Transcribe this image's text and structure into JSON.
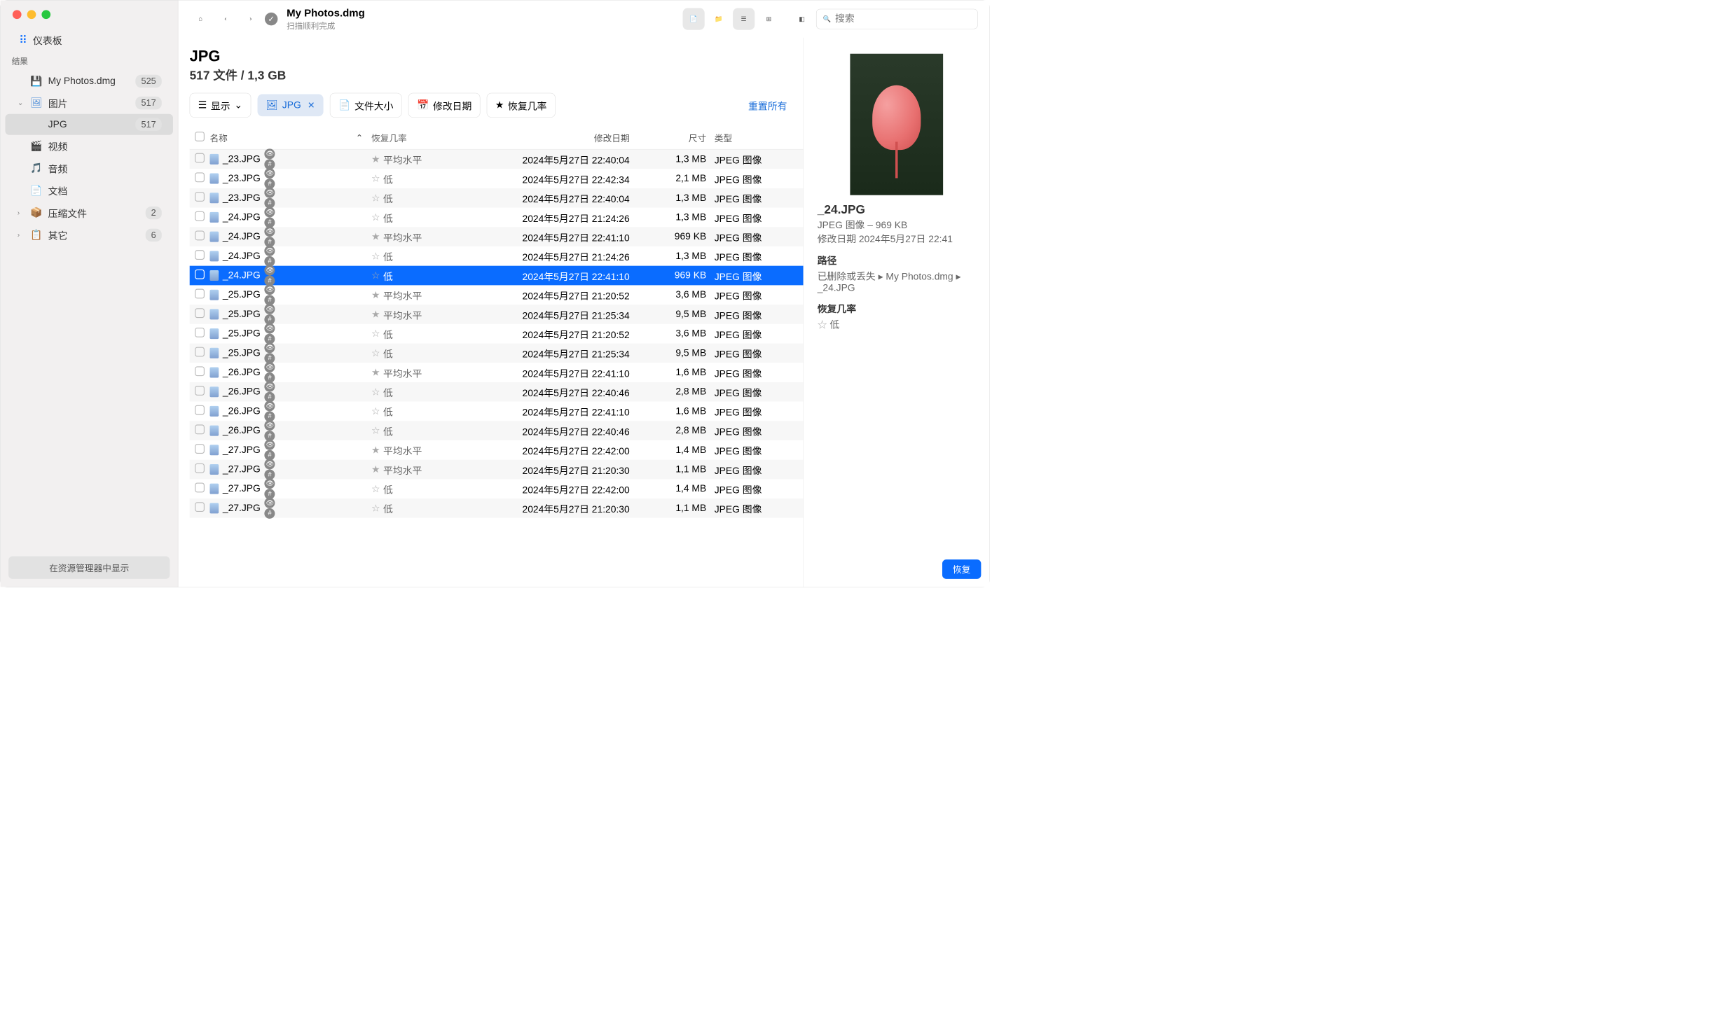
{
  "window": {
    "title": "My Photos.dmg",
    "status": "扫描顺利完成"
  },
  "search": {
    "placeholder": "搜索"
  },
  "sidebar": {
    "dashboard": "仪表板",
    "section": "结果",
    "items": [
      {
        "label": "My Photos.dmg",
        "badge": "525"
      },
      {
        "label": "图片",
        "badge": "517"
      },
      {
        "label": "JPG",
        "badge": "517",
        "selected": true
      },
      {
        "label": "视频"
      },
      {
        "label": "音频"
      },
      {
        "label": "文档"
      },
      {
        "label": "压缩文件",
        "badge": "2"
      },
      {
        "label": "其它",
        "badge": "6"
      }
    ],
    "bottom": "在资源管理器中显示"
  },
  "heading": {
    "title": "JPG",
    "subtitle": "517 文件 / 1,3 GB"
  },
  "filters": {
    "show": "显示",
    "jpg": "JPG",
    "size": "文件大小",
    "date": "修改日期",
    "recovery": "恢复几率",
    "reset": "重置所有"
  },
  "cols": {
    "name": "名称",
    "recovery": "恢复几率",
    "date": "修改日期",
    "size": "尺寸",
    "type": "类型"
  },
  "rows": [
    {
      "name": "_23.JPG",
      "rec": "平均水平",
      "date": "2024年5月27日 22:40:04",
      "size": "1,3 MB",
      "type": "JPEG 图像"
    },
    {
      "name": "_23.JPG",
      "rec": "低",
      "date": "2024年5月27日 22:42:34",
      "size": "2,1 MB",
      "type": "JPEG 图像"
    },
    {
      "name": "_23.JPG",
      "rec": "低",
      "date": "2024年5月27日 22:40:04",
      "size": "1,3 MB",
      "type": "JPEG 图像"
    },
    {
      "name": "_24.JPG",
      "rec": "低",
      "date": "2024年5月27日 21:24:26",
      "size": "1,3 MB",
      "type": "JPEG 图像"
    },
    {
      "name": "_24.JPG",
      "rec": "平均水平",
      "date": "2024年5月27日 22:41:10",
      "size": "969 KB",
      "type": "JPEG 图像"
    },
    {
      "name": "_24.JPG",
      "rec": "低",
      "date": "2024年5月27日 21:24:26",
      "size": "1,3 MB",
      "type": "JPEG 图像"
    },
    {
      "name": "_24.JPG",
      "rec": "低",
      "date": "2024年5月27日 22:41:10",
      "size": "969 KB",
      "type": "JPEG 图像",
      "selected": true
    },
    {
      "name": "_25.JPG",
      "rec": "平均水平",
      "date": "2024年5月27日 21:20:52",
      "size": "3,6 MB",
      "type": "JPEG 图像"
    },
    {
      "name": "_25.JPG",
      "rec": "平均水平",
      "date": "2024年5月27日 21:25:34",
      "size": "9,5 MB",
      "type": "JPEG 图像"
    },
    {
      "name": "_25.JPG",
      "rec": "低",
      "date": "2024年5月27日 21:20:52",
      "size": "3,6 MB",
      "type": "JPEG 图像"
    },
    {
      "name": "_25.JPG",
      "rec": "低",
      "date": "2024年5月27日 21:25:34",
      "size": "9,5 MB",
      "type": "JPEG 图像",
      "hover": true
    },
    {
      "name": "_26.JPG",
      "rec": "平均水平",
      "date": "2024年5月27日 22:41:10",
      "size": "1,6 MB",
      "type": "JPEG 图像"
    },
    {
      "name": "_26.JPG",
      "rec": "低",
      "date": "2024年5月27日 22:40:46",
      "size": "2,8 MB",
      "type": "JPEG 图像"
    },
    {
      "name": "_26.JPG",
      "rec": "低",
      "date": "2024年5月27日 22:41:10",
      "size": "1,6 MB",
      "type": "JPEG 图像"
    },
    {
      "name": "_26.JPG",
      "rec": "低",
      "date": "2024年5月27日 22:40:46",
      "size": "2,8 MB",
      "type": "JPEG 图像"
    },
    {
      "name": "_27.JPG",
      "rec": "平均水平",
      "date": "2024年5月27日 22:42:00",
      "size": "1,4 MB",
      "type": "JPEG 图像"
    },
    {
      "name": "_27.JPG",
      "rec": "平均水平",
      "date": "2024年5月27日 21:20:30",
      "size": "1,1 MB",
      "type": "JPEG 图像"
    },
    {
      "name": "_27.JPG",
      "rec": "低",
      "date": "2024年5月27日 22:42:00",
      "size": "1,4 MB",
      "type": "JPEG 图像"
    },
    {
      "name": "_27.JPG",
      "rec": "低",
      "date": "2024年5月27日 21:20:30",
      "size": "1,1 MB",
      "type": "JPEG 图像"
    }
  ],
  "details": {
    "filename": "_24.JPG",
    "meta": "JPEG 图像 – 969 KB",
    "modified_label": "修改日期",
    "modified": "2024年5月27日 22:41",
    "path_label": "路径",
    "path": "已删除或丢失 ▸ My Photos.dmg ▸ _24.JPG",
    "recovery_label": "恢复几率",
    "recovery": "低",
    "button": "恢复"
  }
}
